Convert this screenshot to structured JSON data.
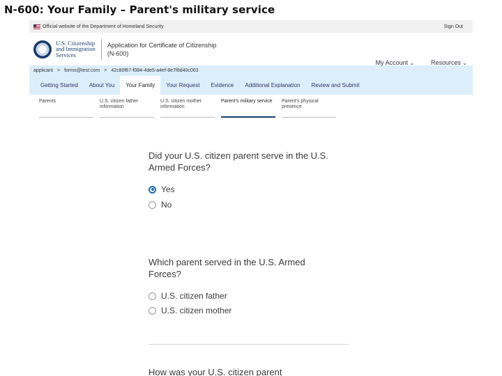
{
  "slide_title": "N-600: Your Family – Parent's military service",
  "gov_banner": {
    "text": "Official website of the Department of Homeland Security",
    "sign_out": "Sign Out"
  },
  "agency": {
    "line1": "U.S. Citizenship",
    "line2": "and Immigration",
    "line3": "Services"
  },
  "app": {
    "title_line1": "Application for Certificate of Citizenship",
    "title_line2": "(N-600)"
  },
  "header_links": {
    "account": "My Account",
    "resources": "Resources"
  },
  "breadcrumb": {
    "applicant": "applicant",
    "email": "forms@test.com",
    "sep": ">",
    "receipt": "42c80f67-f084-4de5-a4ef-8e7f8d40c063"
  },
  "tabs": [
    "Getting Started",
    "About You",
    "Your Family",
    "Your Request",
    "Evidence",
    "Additional Explanation",
    "Review and Submit"
  ],
  "active_tab": 2,
  "subtabs": [
    {
      "line1": "Parents",
      "line2": ""
    },
    {
      "line1": "U.S. citizen father",
      "line2": "information"
    },
    {
      "line1": "U.S. citizen mother",
      "line2": "information"
    },
    {
      "line1": "Parent's military service",
      "line2": ""
    },
    {
      "line1": "Parent's physical",
      "line2": "presence"
    }
  ],
  "active_subtab": 3,
  "q1": {
    "text_line1": "Did your U.S. citizen parent serve in the U.S.",
    "text_line2": "Armed Forces?",
    "options": [
      "Yes",
      "No"
    ],
    "selected": "Yes"
  },
  "q2": {
    "text_line1": "Which parent served in the U.S. Armed",
    "text_line2": "Forces?",
    "options": [
      "U.S. citizen father",
      "U.S. citizen mother"
    ]
  },
  "q3": {
    "text_line1": "How was your U.S. citizen parent"
  },
  "icons": {
    "flag": "us-flag-icon",
    "seal": "dhs-seal-icon",
    "chevron": "chevron-down-icon"
  }
}
